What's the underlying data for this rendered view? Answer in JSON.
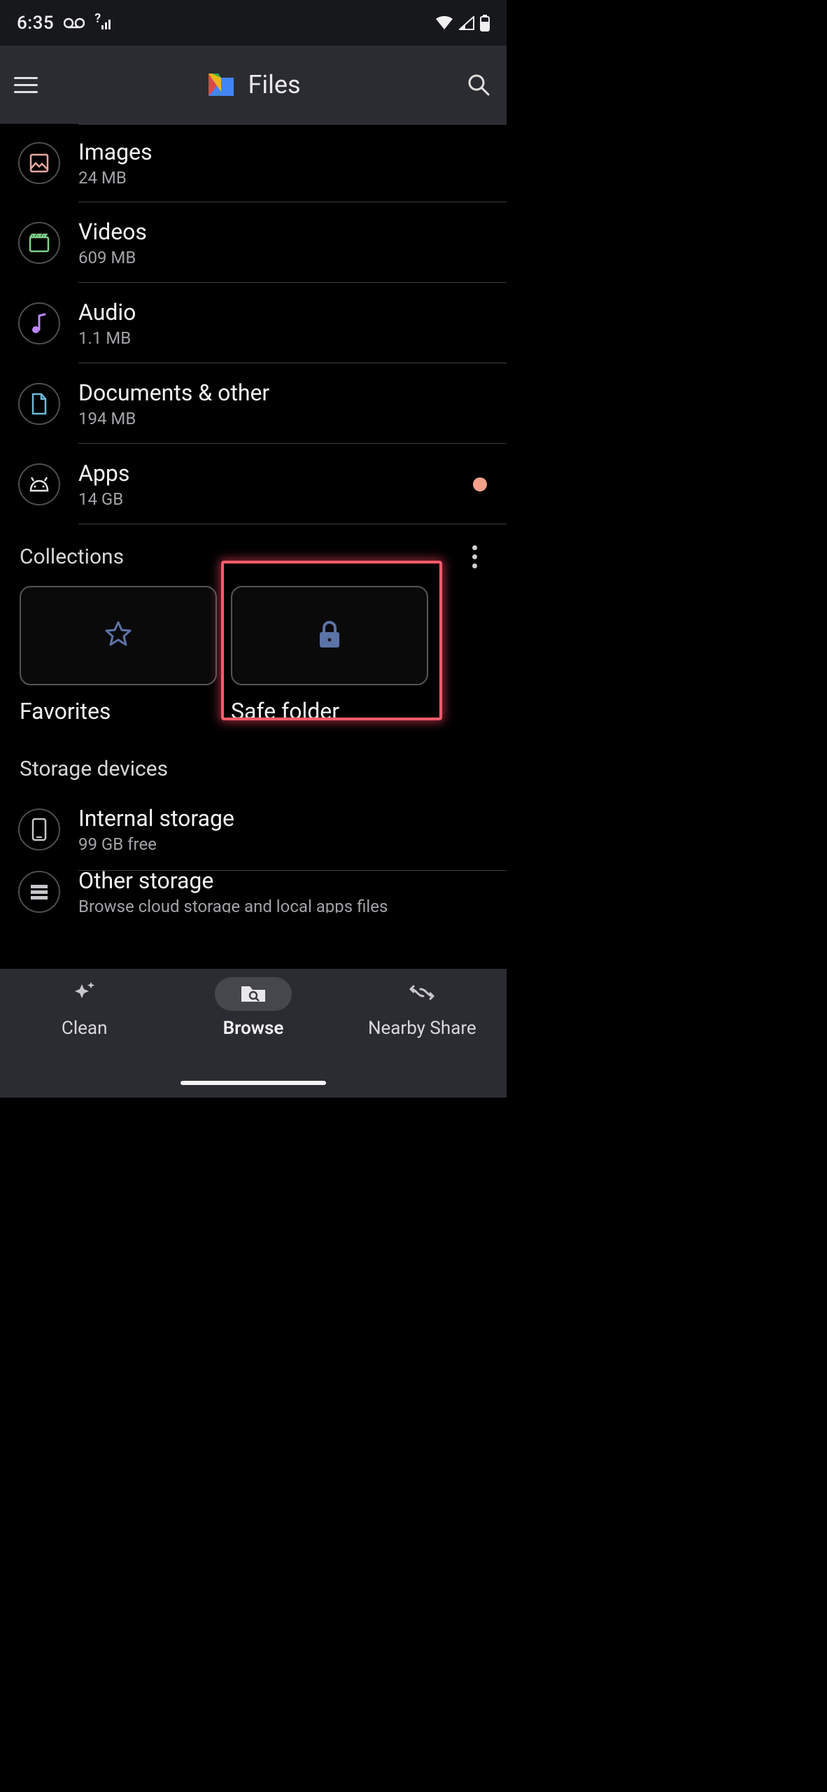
{
  "statusbar": {
    "time": "6:35"
  },
  "appbar": {
    "title": "Files"
  },
  "categories": [
    {
      "id": "images",
      "title": "Images",
      "sub": "24 MB",
      "icon": "image",
      "color": "#e9a8a0"
    },
    {
      "id": "videos",
      "title": "Videos",
      "sub": "609 MB",
      "icon": "video",
      "color": "#7fd08a"
    },
    {
      "id": "audio",
      "title": "Audio",
      "sub": "1.1 MB",
      "icon": "audio",
      "color": "#bb86fc"
    },
    {
      "id": "documents",
      "title": "Documents & other",
      "sub": "194 MB",
      "icon": "document",
      "color": "#6fb8d6"
    },
    {
      "id": "apps",
      "title": "Apps",
      "sub": "14 GB",
      "icon": "apps",
      "color": "#e5e5e7",
      "badge": true
    }
  ],
  "collections": {
    "header": "Collections",
    "items": [
      {
        "id": "favorites",
        "label": "Favorites",
        "icon": "star"
      },
      {
        "id": "safe-folder",
        "label": "Safe folder",
        "icon": "lock",
        "highlighted": true
      }
    ]
  },
  "storage": {
    "header": "Storage devices",
    "items": [
      {
        "id": "internal",
        "title": "Internal storage",
        "sub": "99 GB free",
        "icon": "phone"
      },
      {
        "id": "other",
        "title": "Other storage",
        "sub": "Browse cloud storage and local apps files",
        "icon": "stack"
      }
    ]
  },
  "bottomnav": {
    "items": [
      {
        "id": "clean",
        "label": "Clean",
        "icon": "sparkle"
      },
      {
        "id": "browse",
        "label": "Browse",
        "icon": "folder-search",
        "active": true
      },
      {
        "id": "nearby",
        "label": "Nearby Share",
        "icon": "swap"
      }
    ]
  }
}
